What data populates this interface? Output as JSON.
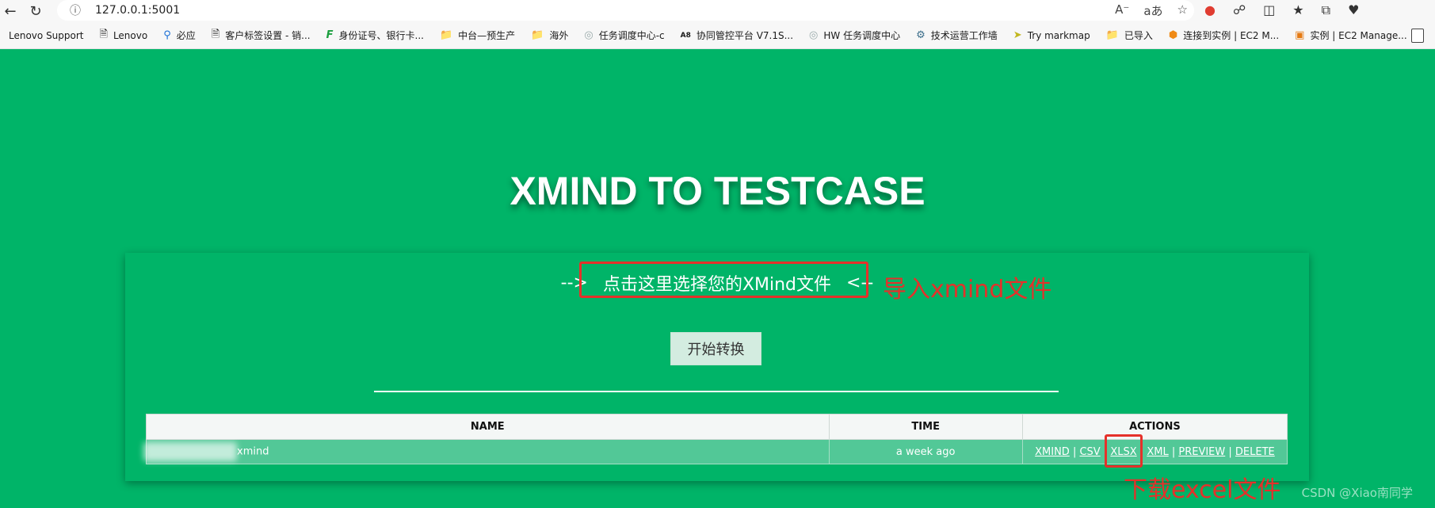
{
  "browser": {
    "url": "127.0.0.1:5001",
    "bookmarks": [
      {
        "label": "Lenovo Support",
        "icon": "none"
      },
      {
        "label": "Lenovo",
        "icon": "page-icon"
      },
      {
        "label": "必应",
        "icon": "search-icon"
      },
      {
        "label": "客户标签设置 - 销...",
        "icon": "page-icon"
      },
      {
        "label": "身份证号、银行卡...",
        "icon": "f-logo-icon"
      },
      {
        "label": "中台—预生产",
        "icon": "folder-icon"
      },
      {
        "label": "海外",
        "icon": "folder-icon"
      },
      {
        "label": "任务调度中心-c",
        "icon": "globe-icon"
      },
      {
        "label": "协同管控平台 V7.1S...",
        "icon": "a8-logo-icon"
      },
      {
        "label": "HW 任务调度中心",
        "icon": "globe-icon"
      },
      {
        "label": "技术运营工作墙",
        "icon": "ops-icon"
      },
      {
        "label": "Try markmap",
        "icon": "markmap-icon"
      },
      {
        "label": "已导入",
        "icon": "folder-icon"
      },
      {
        "label": "连接到实例 | EC2 M...",
        "icon": "cube-icon"
      },
      {
        "label": "实例 | EC2 Manage...",
        "icon": "ec2-icon"
      }
    ]
  },
  "page": {
    "title": "XMIND TO TESTCASE",
    "upload": {
      "prefix": "-->",
      "label": "点击这里选择您的XMind文件",
      "suffix": "<--"
    },
    "convert_button": "开始转换",
    "table": {
      "headers": [
        "NAME",
        "TIME",
        "ACTIONS"
      ],
      "rows": [
        {
          "name": "xmind",
          "time": "a week ago",
          "actions": [
            "XMIND",
            "CSV",
            "XLSX",
            "XML",
            "PREVIEW",
            "DELETE"
          ]
        }
      ]
    }
  },
  "annotations": {
    "import": "导入xmind文件",
    "download": "下载excel文件"
  },
  "watermark": "CSDN @Xiao南同学",
  "colors": {
    "page_bg": "#00b468",
    "row_bg": "#52c897",
    "annotation_red": "#e5312a"
  }
}
